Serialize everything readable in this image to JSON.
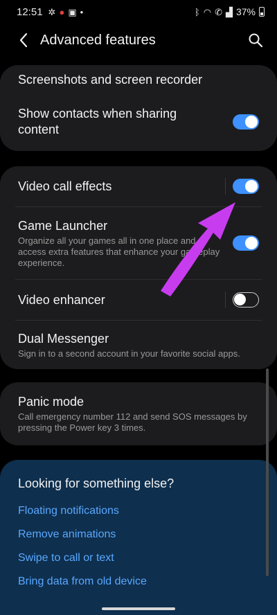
{
  "status_bar": {
    "time": "12:51",
    "battery": "37%",
    "icons": [
      "nfc-icon",
      "notification-icon",
      "gallery-icon",
      "dot-icon",
      "bluetooth-icon",
      "wifi-icon",
      "call-icon",
      "signal-icon",
      "battery-icon"
    ]
  },
  "header": {
    "title": "Advanced features"
  },
  "card1": {
    "items": [
      {
        "label": "Screenshots and screen recorder"
      },
      {
        "label": "Show contacts when sharing content",
        "toggle": true
      }
    ]
  },
  "card2": {
    "items": [
      {
        "label": "Video call effects",
        "toggle": true
      },
      {
        "label": "Game Launcher",
        "desc": "Organize all your games all in one place and access extra features that enhance your gameplay experience.",
        "toggle": true
      },
      {
        "label": "Video enhancer",
        "toggle": false
      },
      {
        "label": "Dual Messenger",
        "desc": "Sign in to a second account in your favorite social apps."
      }
    ]
  },
  "card3": {
    "items": [
      {
        "label": "Panic mode",
        "desc": "Call emergency number 112 and send SOS messages by pressing the Power key 3 times."
      }
    ]
  },
  "help": {
    "heading": "Looking for something else?",
    "links": [
      "Floating notifications",
      "Remove animations",
      "Swipe to call or text",
      "Bring data from old device"
    ]
  },
  "colors": {
    "accent": "#3e91ff",
    "link": "#5aa8ff",
    "card": "#1c1c1e",
    "help_panel": "#0e2f4e",
    "annotation_arrow": "#c83cf0"
  }
}
